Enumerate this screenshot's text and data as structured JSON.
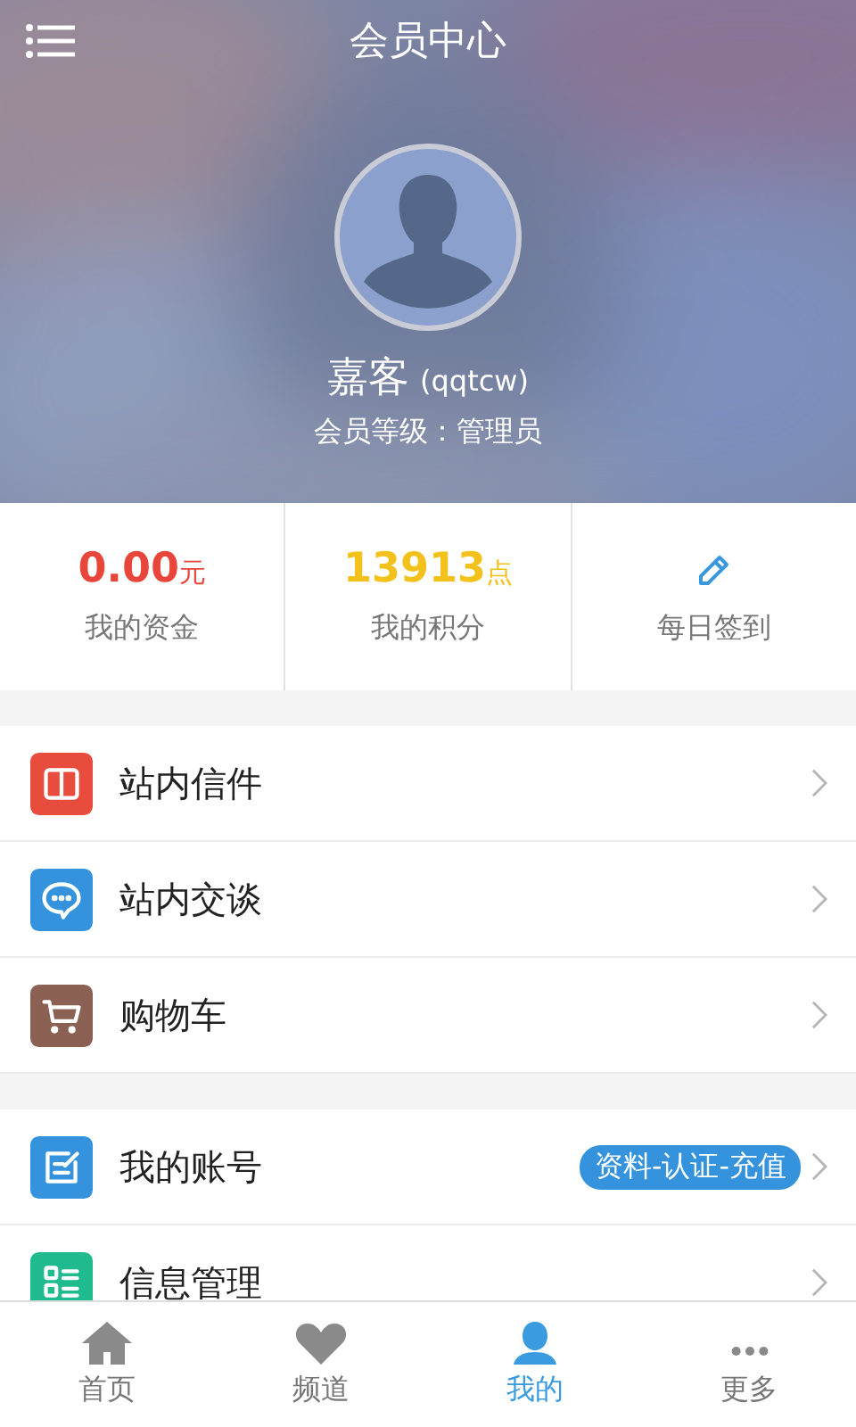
{
  "header": {
    "title": "会员中心",
    "user_name": "嘉客",
    "user_id": "(qqtcw)",
    "member_level": "会员等级：管理员"
  },
  "stats": [
    {
      "kind": "money",
      "value": "0.00",
      "unit": "元",
      "label": "我的资金",
      "color": "#e8463a"
    },
    {
      "kind": "points",
      "value": "13913",
      "unit": "点",
      "label": "我的积分",
      "color": "#f2c11c"
    },
    {
      "kind": "checkin",
      "label": "每日签到",
      "color": "#3a98dc"
    }
  ],
  "menu_groups": [
    [
      {
        "kind": "book",
        "color": "#e84c3d",
        "label": "站内信件"
      },
      {
        "kind": "chat",
        "color": "#3493dc",
        "label": "站内交谈"
      },
      {
        "kind": "cart",
        "color": "#8a6152",
        "label": "购物车"
      }
    ],
    [
      {
        "kind": "edit",
        "color": "#3493dc",
        "label": "我的账号",
        "badge": "资料-认证-充值"
      },
      {
        "kind": "list",
        "color": "#1fbb8f",
        "label": "信息管理"
      }
    ]
  ],
  "tabs": [
    {
      "kind": "home",
      "label": "首页",
      "selected": false
    },
    {
      "kind": "heart",
      "label": "频道",
      "selected": false
    },
    {
      "kind": "person",
      "label": "我的",
      "selected": true
    },
    {
      "kind": "more",
      "label": "更多",
      "selected": false
    }
  ]
}
